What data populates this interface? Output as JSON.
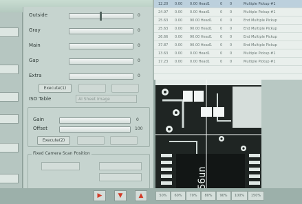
{
  "params": [
    {
      "label": "Outside",
      "value": "0"
    },
    {
      "label": "Gray",
      "value": "0"
    },
    {
      "label": "Main",
      "value": "0"
    },
    {
      "label": "Gap",
      "value": "0"
    },
    {
      "label": "Extra",
      "value": "0"
    }
  ],
  "buttons1": [
    "Execute(1)",
    "",
    ""
  ],
  "iso": {
    "label": "ISO Table",
    "dropdown": "AI Sheet Image"
  },
  "gain_offset": [
    {
      "label": "Gain",
      "value": "0"
    },
    {
      "label": "Offset",
      "value": "100"
    }
  ],
  "buttons2": [
    "Execute(2)",
    "",
    ""
  ],
  "fixed_camera": {
    "title": "Fixed Camera Scan Position"
  },
  "table_rows": [
    {
      "c1": "12.20",
      "c2": "0.00",
      "c3": "0.00 Head1",
      "c4": "0",
      "c5": "0",
      "c6": "Multiple Pickup #1"
    },
    {
      "c1": "24.97",
      "c2": "0.00",
      "c3": "0.00 Head1",
      "c4": "0",
      "c5": "0",
      "c6": "Multiple Pickup #1"
    },
    {
      "c1": "25.63",
      "c2": "0.00",
      "c3": "90.00 Head1",
      "c4": "0",
      "c5": "0",
      "c6": "End Multiple Pickup"
    },
    {
      "c1": "25.63",
      "c2": "0.00",
      "c3": "90.00 Head1",
      "c4": "0",
      "c5": "0",
      "c6": "End Multiple Pickup"
    },
    {
      "c1": "26.66",
      "c2": "0.00",
      "c3": "90.00 Head1",
      "c4": "0",
      "c5": "0",
      "c6": "End Multiple Pickup"
    },
    {
      "c1": "37.87",
      "c2": "0.00",
      "c3": "90.00 Head1",
      "c4": "0",
      "c5": "0",
      "c6": "End Multiple Pickup"
    },
    {
      "c1": "13.63",
      "c2": "0.00",
      "c3": "0.00 Head1",
      "c4": "0",
      "c5": "0",
      "c6": "Multiple Pickup #1"
    },
    {
      "c1": "17.23",
      "c2": "0.00",
      "c3": "0.00 Head1",
      "c4": "0",
      "c5": "0",
      "c6": "Multiple Pickup #1"
    },
    {
      "c1": "",
      "c2": "",
      "c3": "",
      "c4": "",
      "c5": "",
      "c6": ""
    },
    {
      "c1": "",
      "c2": "",
      "c3": "",
      "c4": "",
      "c5": "",
      "c6": ""
    }
  ],
  "zoom_buttons": [
    "50%",
    "60%",
    "70%",
    "80%",
    "90%",
    "100%",
    "150%"
  ],
  "camera_overlay": "56un"
}
